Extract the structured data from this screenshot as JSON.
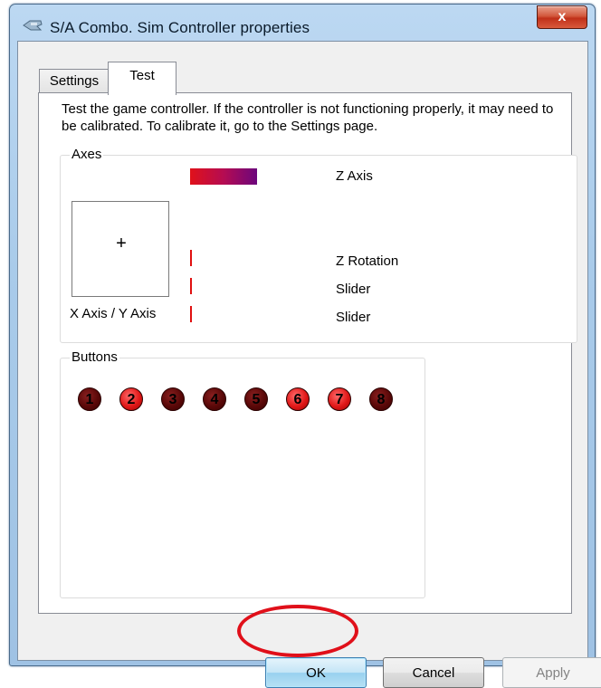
{
  "window": {
    "title": "S/A Combo. Sim Controller properties",
    "close_label": "x",
    "icon": "game-controller-icon"
  },
  "tabs": [
    {
      "label": "Settings",
      "selected": false
    },
    {
      "label": "Test",
      "selected": true
    }
  ],
  "test_page": {
    "intro": "Test the game controller.  If the controller is not functioning properly, it may need to be calibrated.  To calibrate it, go to the Settings page.",
    "axes": {
      "group_label": "Axes",
      "xy_label": "X Axis / Y Axis",
      "crosshair": "+",
      "z_axis_label": "Z Axis",
      "z_axis_level": 1.0,
      "z_rotation_label": "Z Rotation",
      "slider1_label": "Slider",
      "slider2_label": "Slider"
    },
    "buttons": {
      "group_label": "Buttons",
      "items": [
        {
          "number": "1",
          "pressed": false
        },
        {
          "number": "2",
          "pressed": true
        },
        {
          "number": "3",
          "pressed": false
        },
        {
          "number": "4",
          "pressed": false
        },
        {
          "number": "5",
          "pressed": false
        },
        {
          "number": "6",
          "pressed": true
        },
        {
          "number": "7",
          "pressed": true
        },
        {
          "number": "8",
          "pressed": false
        }
      ]
    }
  },
  "dialog_buttons": {
    "ok": "OK",
    "cancel": "Cancel",
    "apply": "Apply",
    "apply_enabled": false
  },
  "colors": {
    "highlight_circle": "#e0101a",
    "pressed_button": "#e01818",
    "released_button": "#5a0808"
  }
}
